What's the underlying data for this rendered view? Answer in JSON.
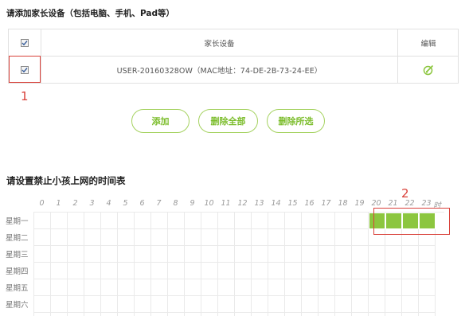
{
  "device_section": {
    "title": "请添加家长设备（包括电脑、手机、Pad等）",
    "table": {
      "header_device": "家长设备",
      "header_edit": "编辑",
      "header_checked": true,
      "rows": [
        {
          "device": "USER-20160328OW（MAC地址：74-DE-2B-73-24-EE）",
          "checked": true,
          "edit_icon": "edit-icon"
        }
      ]
    },
    "annotation_1": "1",
    "buttons": {
      "add": "添加",
      "delete_all": "删除全部",
      "delete_selected": "删除所选"
    }
  },
  "schedule_section": {
    "title": "请设置禁止小孩上网的时间表",
    "hours": [
      "0",
      "1",
      "2",
      "3",
      "4",
      "5",
      "6",
      "7",
      "8",
      "9",
      "10",
      "11",
      "12",
      "13",
      "14",
      "15",
      "16",
      "17",
      "18",
      "19",
      "20",
      "21",
      "22",
      "23"
    ],
    "hour_unit": "时",
    "days": [
      "星期一",
      "星期二",
      "星期三",
      "星期四",
      "星期五",
      "星期六"
    ],
    "selected": [
      {
        "day": "星期一",
        "hours": [
          20,
          21,
          22,
          23
        ]
      }
    ],
    "annotation_2": "2"
  },
  "colors": {
    "accent_green": "#8cc63f",
    "button_text": "#7cbd2c",
    "annotation_red": "#d9413a"
  }
}
